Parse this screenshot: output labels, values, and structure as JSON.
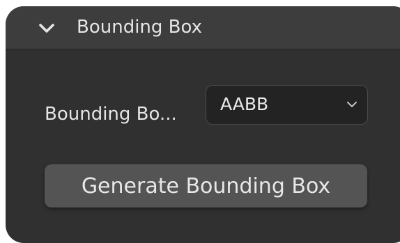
{
  "panel": {
    "title": "Bounding Box",
    "collapse_icon": "chevron-down-icon",
    "expanded": true
  },
  "property": {
    "label": "Bounding Bo...",
    "selected_value": "AABB",
    "dropdown_icon": "chevron-down-icon"
  },
  "actions": {
    "generate_label": "Generate Bounding Box"
  },
  "colors": {
    "panel_bg": "#303030",
    "header_bg": "#3d3d3d",
    "dropdown_bg": "#232323",
    "button_bg": "#545454",
    "text": "#e6e6e6"
  }
}
